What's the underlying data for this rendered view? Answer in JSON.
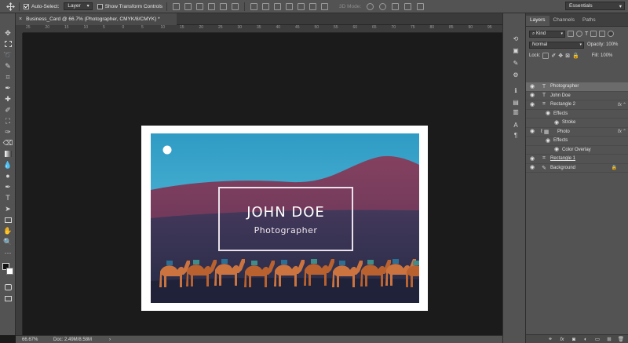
{
  "options_bar": {
    "auto_select_label": "Auto-Select:",
    "auto_select_checked": true,
    "auto_select_target": "Layer",
    "show_transform_label": "Show Transform Controls",
    "show_transform_checked": false,
    "mode_3d_label": "3D Mode:"
  },
  "workspace": {
    "label": "Essentials"
  },
  "document": {
    "tab_title": "Business_Card @ 66.7% (Photographer, CMYK/8/CMYK) *",
    "close_glyph": "×"
  },
  "ruler": {
    "ticks": [
      "25",
      "20",
      "15",
      "10",
      "5",
      "0",
      "5",
      "10",
      "15",
      "20",
      "25",
      "30",
      "35",
      "40",
      "45",
      "50",
      "55",
      "60",
      "65",
      "70",
      "75",
      "80",
      "85",
      "90",
      "95"
    ]
  },
  "card": {
    "name": "JOHN DOE",
    "title": "Photographer"
  },
  "status_bar": {
    "zoom": "66.67%",
    "doc": "Doc: 2.49M/8.58M",
    "arrow": "›"
  },
  "panel": {
    "tabs": [
      "Layers",
      "Channels",
      "Paths"
    ],
    "active_tab": "Layers",
    "filter_label": "Kind",
    "blend_mode": "Normal",
    "opacity_label": "Opacity:",
    "opacity_value": "100%",
    "lock_label": "Lock:",
    "fill_label": "Fill:",
    "fill_value": "100%",
    "layers": [
      {
        "label": "Photographer",
        "kind": "text",
        "selected": true
      },
      {
        "label": "John Doe",
        "kind": "text"
      },
      {
        "label": "Rectangle 2",
        "kind": "shape",
        "fx": "fx"
      },
      {
        "label": "Effects",
        "kind": "effects-header"
      },
      {
        "label": "Stroke",
        "kind": "effect"
      },
      {
        "label": "Photo",
        "kind": "smart",
        "fx": "fx"
      },
      {
        "label": "Effects",
        "kind": "effects-header"
      },
      {
        "label": "Color Overlay",
        "kind": "effect"
      },
      {
        "label": "Rectangle 1",
        "kind": "shape"
      },
      {
        "label": "Background",
        "kind": "background",
        "locked": true
      }
    ]
  },
  "colors": {
    "app_bg": "#1b1b1b",
    "chrome": "#535353",
    "panel_dark": "#3d3d3d",
    "sky_top": "#2f9bc4",
    "sky_bottom": "#5fc3e0",
    "dune_pink": "#7a3a5c",
    "desert_navy": "#2f3552",
    "card_white": "#ffffff",
    "camel": "#c8703a"
  }
}
